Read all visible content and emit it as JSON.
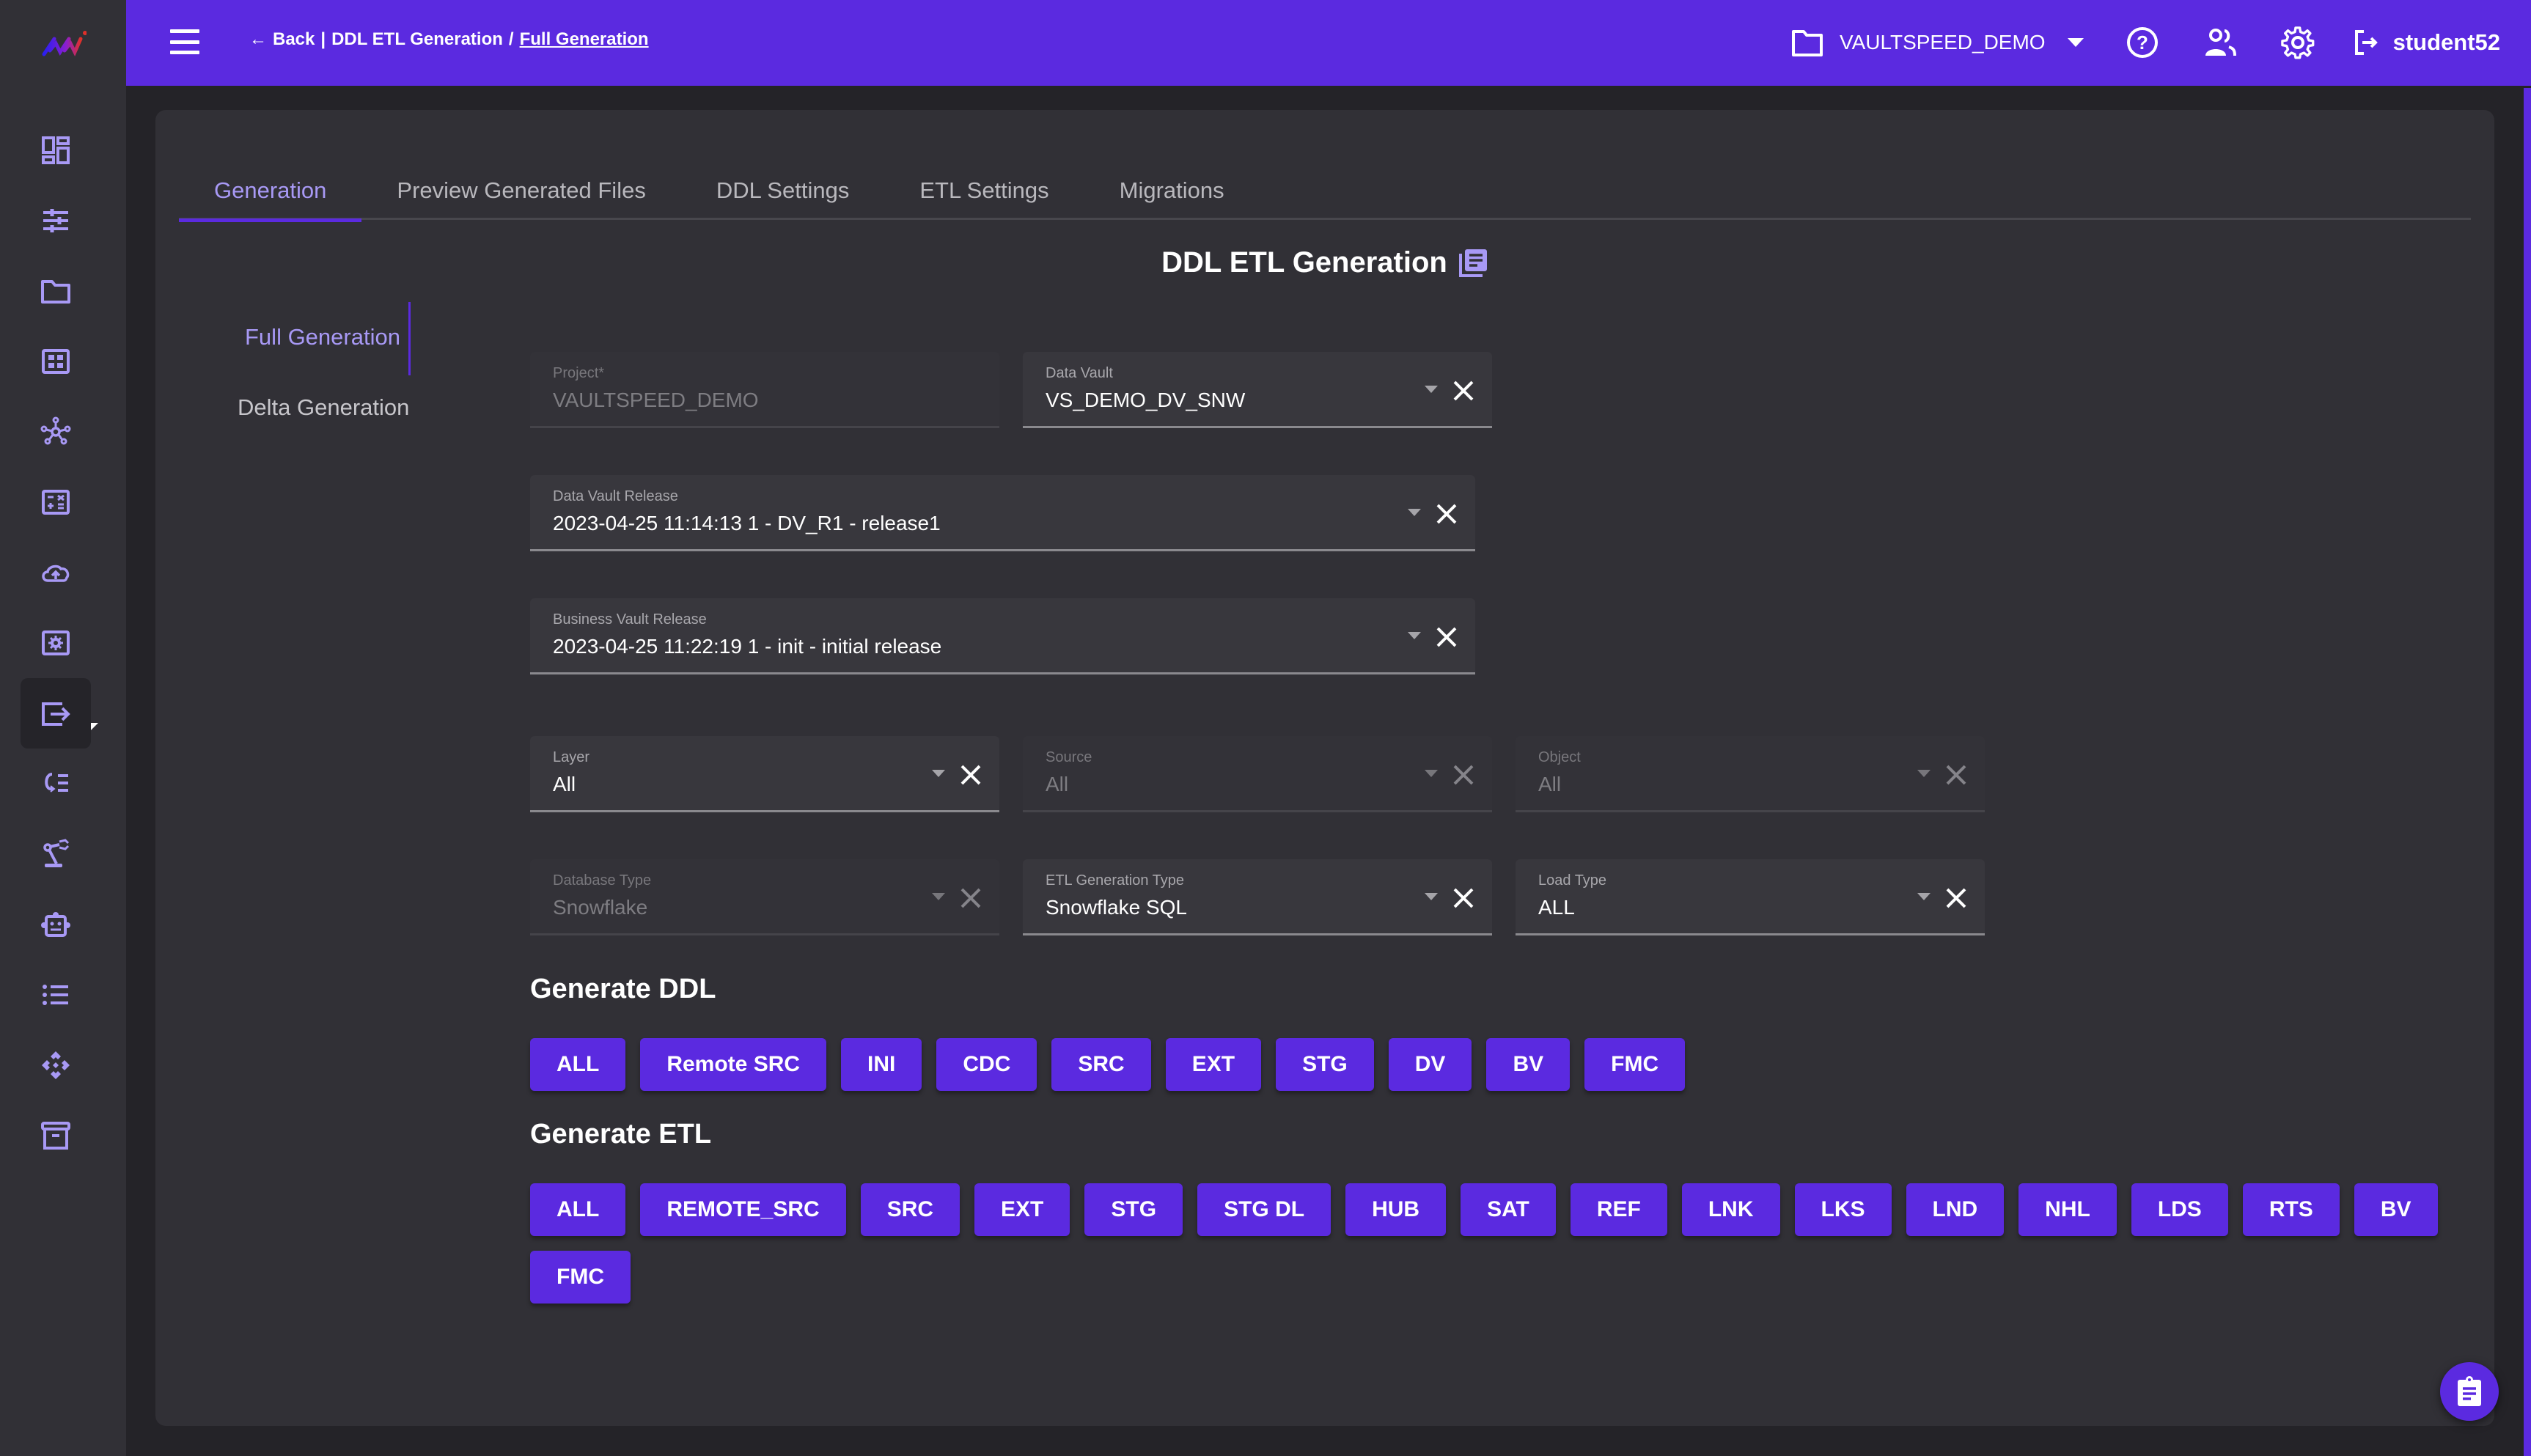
{
  "header": {
    "breadcrumb": {
      "back_label": "Back",
      "separator": "|",
      "parent": "DDL ETL Generation",
      "slash": "/",
      "current": "Full Generation"
    },
    "project_selector": "VAULTSPEED_DEMO",
    "username": "student52",
    "icons": [
      "menu-icon",
      "folder-icon",
      "help-icon",
      "users-icon",
      "settings-icon",
      "logout-icon"
    ]
  },
  "sidebar": {
    "items": [
      {
        "icon": "dashboard-icon"
      },
      {
        "icon": "tune-icon"
      },
      {
        "icon": "folder-icon"
      },
      {
        "icon": "grid-icon"
      },
      {
        "icon": "hub-icon"
      },
      {
        "icon": "calculator-icon"
      },
      {
        "icon": "cloud-upload-icon"
      },
      {
        "icon": "settings-box-icon"
      },
      {
        "icon": "export-icon",
        "active": true
      },
      {
        "icon": "repeat-list-icon"
      },
      {
        "icon": "robot-arm-icon"
      },
      {
        "icon": "robot-icon"
      },
      {
        "icon": "list-icon"
      },
      {
        "icon": "diamond-grid-icon"
      },
      {
        "icon": "archive-icon"
      }
    ]
  },
  "tabs": [
    {
      "label": "Generation",
      "active": true
    },
    {
      "label": "Preview Generated Files"
    },
    {
      "label": "DDL Settings"
    },
    {
      "label": "ETL Settings"
    },
    {
      "label": "Migrations"
    }
  ],
  "page_title": "DDL ETL Generation",
  "subnav": [
    {
      "label": "Full Generation",
      "active": true
    },
    {
      "label": "Delta Generation"
    }
  ],
  "fields": {
    "project": {
      "label": "Project*",
      "value": "VAULTSPEED_DEMO",
      "disabled": true
    },
    "data_vault": {
      "label": "Data Vault",
      "value": "VS_DEMO_DV_SNW"
    },
    "dv_release": {
      "label": "Data Vault Release",
      "value": "2023-04-25 11:14:13 1 - DV_R1 - release1"
    },
    "bv_release": {
      "label": "Business Vault Release",
      "value": "2023-04-25 11:22:19 1 - init - initial release"
    },
    "layer": {
      "label": "Layer",
      "value": "All"
    },
    "source": {
      "label": "Source",
      "value": "All",
      "disabled": true
    },
    "object": {
      "label": "Object",
      "value": "All",
      "disabled": true
    },
    "database_type": {
      "label": "Database Type",
      "value": "Snowflake",
      "disabled": true
    },
    "etl_generation_type": {
      "label": "ETL Generation Type",
      "value": "Snowflake SQL"
    },
    "load_type": {
      "label": "Load Type",
      "value": "ALL"
    }
  },
  "generate_ddl": {
    "title": "Generate DDL",
    "buttons": [
      "ALL",
      "Remote SRC",
      "INI",
      "CDC",
      "SRC",
      "EXT",
      "STG",
      "DV",
      "BV",
      "FMC"
    ]
  },
  "generate_etl": {
    "title": "Generate ETL",
    "buttons": [
      "ALL",
      "REMOTE_SRC",
      "SRC",
      "EXT",
      "STG",
      "STG DL",
      "HUB",
      "SAT",
      "REF",
      "LNK",
      "LKS",
      "LND",
      "NHL",
      "LDS",
      "RTS",
      "BV",
      "FMC"
    ]
  },
  "colors": {
    "accent": "#5b2ae0",
    "accent_light": "#a899f5",
    "background": "#242328",
    "card": "#313036"
  }
}
